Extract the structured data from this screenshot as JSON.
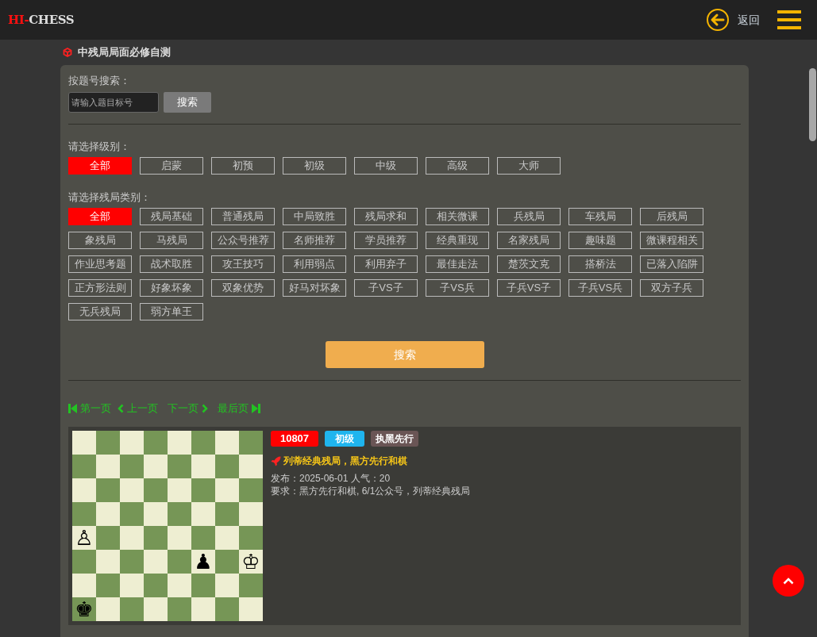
{
  "header": {
    "logo_prefix": "HI-",
    "logo_suffix": "CHESS",
    "back_label": "返回"
  },
  "page_title": "中残局局面必修自测",
  "id_search": {
    "label": "按题号搜索：",
    "placeholder": "请输入题目标号",
    "button": "搜索"
  },
  "levels": {
    "label": "请选择级别：",
    "options": [
      {
        "label": "全部",
        "selected": true
      },
      {
        "label": "启蒙",
        "selected": false
      },
      {
        "label": "初预",
        "selected": false
      },
      {
        "label": "初级",
        "selected": false
      },
      {
        "label": "中级",
        "selected": false
      },
      {
        "label": "高级",
        "selected": false
      },
      {
        "label": "大师",
        "selected": false
      }
    ]
  },
  "categories": {
    "label": "请选择残局类别：",
    "options": [
      {
        "label": "全部",
        "selected": true
      },
      {
        "label": "残局基础",
        "selected": false
      },
      {
        "label": "普通残局",
        "selected": false
      },
      {
        "label": "中局致胜",
        "selected": false
      },
      {
        "label": "残局求和",
        "selected": false
      },
      {
        "label": "相关微课",
        "selected": false
      },
      {
        "label": "兵残局",
        "selected": false
      },
      {
        "label": "车残局",
        "selected": false
      },
      {
        "label": "后残局",
        "selected": false
      },
      {
        "label": "象残局",
        "selected": false
      },
      {
        "label": "马残局",
        "selected": false
      },
      {
        "label": "公众号推荐",
        "selected": false
      },
      {
        "label": "名师推荐",
        "selected": false
      },
      {
        "label": "学员推荐",
        "selected": false
      },
      {
        "label": "经典重现",
        "selected": false
      },
      {
        "label": "名家残局",
        "selected": false
      },
      {
        "label": "趣味题",
        "selected": false
      },
      {
        "label": "微课程相关",
        "selected": false
      },
      {
        "label": "作业思考题",
        "selected": false
      },
      {
        "label": "战术取胜",
        "selected": false
      },
      {
        "label": "攻王技巧",
        "selected": false
      },
      {
        "label": "利用弱点",
        "selected": false
      },
      {
        "label": "利用弃子",
        "selected": false
      },
      {
        "label": "最佳走法",
        "selected": false
      },
      {
        "label": "楚茨文克",
        "selected": false
      },
      {
        "label": "搭桥法",
        "selected": false
      },
      {
        "label": "已落入陷阱",
        "selected": false
      },
      {
        "label": "正方形法则",
        "selected": false
      },
      {
        "label": "好象坏象",
        "selected": false
      },
      {
        "label": "双象优势",
        "selected": false
      },
      {
        "label": "好马对坏象",
        "selected": false
      },
      {
        "label": "子VS子",
        "selected": false
      },
      {
        "label": "子VS兵",
        "selected": false
      },
      {
        "label": "子兵VS子",
        "selected": false
      },
      {
        "label": "子兵VS兵",
        "selected": false
      },
      {
        "label": "双方子兵",
        "selected": false
      },
      {
        "label": "无兵残局",
        "selected": false
      },
      {
        "label": "弱方单王",
        "selected": false
      }
    ]
  },
  "search_button": "搜索",
  "pagination": {
    "first": "第一页",
    "prev": "上一页",
    "next": "下一页",
    "last": "最后页"
  },
  "puzzles": [
    {
      "number": "10807",
      "level": "初级",
      "side_to_move": "执黑先行",
      "title": "列蒂经典残局，黑方先行和棋",
      "meta": "发布：2025-06-01 人气：20",
      "requirement": "要求：黑方先行和棋, 6/1公众号，列蒂经典残局",
      "ranks": [
        [
          {
            "kind": "empty"
          },
          {
            "kind": "empty"
          },
          {
            "kind": "empty"
          },
          {
            "kind": "empty"
          },
          {
            "kind": "empty"
          },
          {
            "kind": "empty"
          },
          {
            "kind": "empty"
          },
          {
            "kind": "empty"
          }
        ],
        [
          {
            "kind": "empty"
          },
          {
            "kind": "empty"
          },
          {
            "kind": "empty"
          },
          {
            "kind": "empty"
          },
          {
            "kind": "empty"
          },
          {
            "kind": "empty"
          },
          {
            "kind": "empty"
          },
          {
            "kind": "empty"
          }
        ],
        [
          {
            "kind": "empty"
          },
          {
            "kind": "empty"
          },
          {
            "kind": "empty"
          },
          {
            "kind": "empty"
          },
          {
            "kind": "empty"
          },
          {
            "kind": "empty"
          },
          {
            "kind": "empty"
          },
          {
            "kind": "empty"
          }
        ],
        [
          {
            "kind": "empty"
          },
          {
            "kind": "empty"
          },
          {
            "kind": "empty"
          },
          {
            "kind": "empty"
          },
          {
            "kind": "empty"
          },
          {
            "kind": "empty"
          },
          {
            "kind": "empty"
          },
          {
            "kind": "empty"
          }
        ],
        [
          {
            "kind": "piece",
            "piece": "♙"
          },
          {
            "kind": "empty"
          },
          {
            "kind": "empty"
          },
          {
            "kind": "empty"
          },
          {
            "kind": "empty"
          },
          {
            "kind": "empty"
          },
          {
            "kind": "empty"
          },
          {
            "kind": "empty"
          }
        ],
        [
          {
            "kind": "empty"
          },
          {
            "kind": "empty"
          },
          {
            "kind": "empty"
          },
          {
            "kind": "empty"
          },
          {
            "kind": "empty"
          },
          {
            "kind": "piece",
            "piece": "♟"
          },
          {
            "kind": "empty"
          },
          {
            "kind": "piece",
            "piece": "♔"
          }
        ],
        [
          {
            "kind": "empty"
          },
          {
            "kind": "empty"
          },
          {
            "kind": "empty"
          },
          {
            "kind": "empty"
          },
          {
            "kind": "empty"
          },
          {
            "kind": "empty"
          },
          {
            "kind": "empty"
          },
          {
            "kind": "empty"
          }
        ],
        [
          {
            "kind": "piece",
            "piece": "♚"
          },
          {
            "kind": "empty"
          },
          {
            "kind": "empty"
          },
          {
            "kind": "empty"
          },
          {
            "kind": "empty"
          },
          {
            "kind": "empty"
          },
          {
            "kind": "empty"
          },
          {
            "kind": "empty"
          }
        ]
      ]
    }
  ]
}
